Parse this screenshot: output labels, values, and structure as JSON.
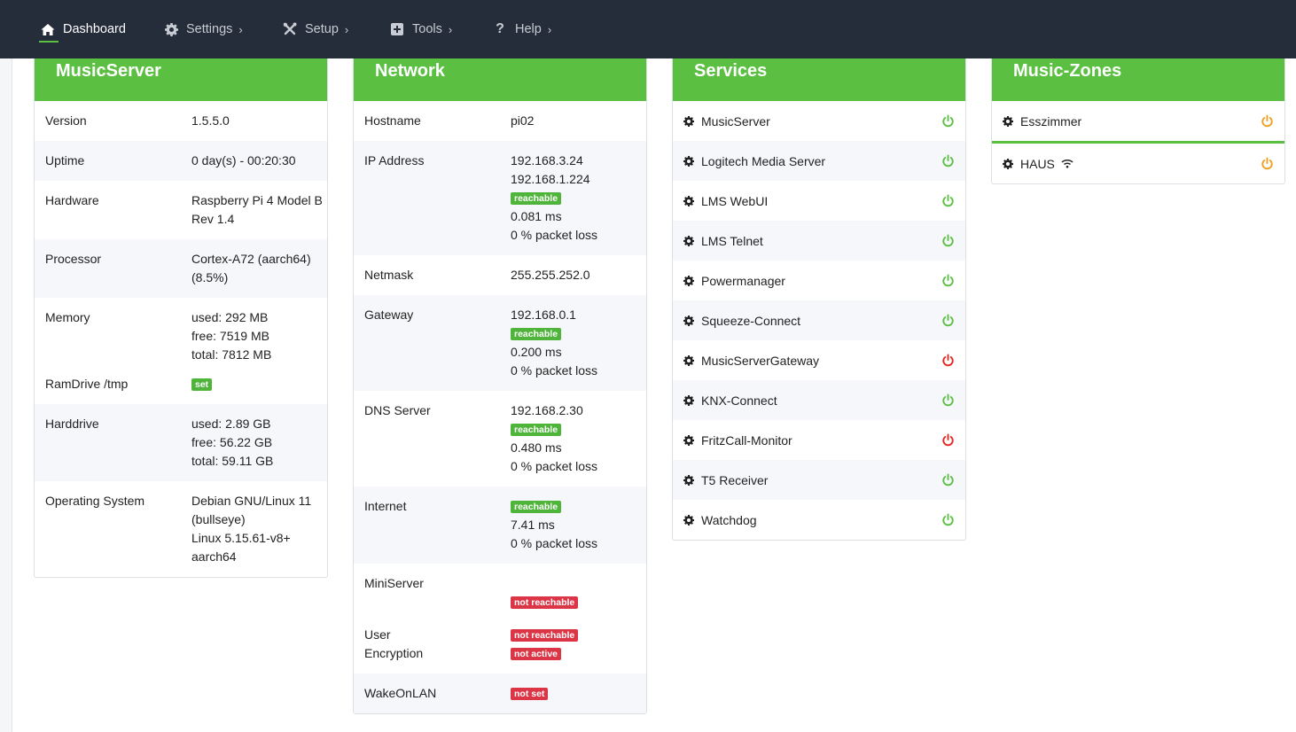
{
  "nav": {
    "dashboard": "Dashboard",
    "settings": "Settings",
    "setup": "Setup",
    "tools": "Tools",
    "help": "Help",
    "chevron": "›"
  },
  "colors": {
    "accent": "#5bbf42",
    "nav_bg": "#252d3a",
    "on": "#5bbf42",
    "off": "#e52620",
    "standby": "#f0a020",
    "danger": "#dc3545"
  },
  "musicserver": {
    "title": "MusicServer",
    "version_k": "Version",
    "version_v": "1.5.5.0",
    "uptime_k": "Uptime",
    "uptime_v": "0 day(s) - 00:20:30",
    "hardware_k": "Hardware",
    "hardware_v": "Raspberry Pi 4 Model B Rev 1.4",
    "processor_k": "Processor",
    "processor_v": "Cortex-A72 (aarch64) (8.5%)",
    "memory_k": "Memory",
    "memory_used": "used: 292 MB",
    "memory_free": "free: 7519 MB",
    "memory_total": "total: 7812 MB",
    "ramdrive_k": "RamDrive /tmp",
    "ramdrive_badge": "set",
    "harddrive_k": "Harddrive",
    "hd_used": "used: 2.89 GB",
    "hd_free": "free: 56.22 GB",
    "hd_total": "total: 59.11 GB",
    "os_k": "Operating System",
    "os_1": "Debian GNU/Linux 11 (bullseye)",
    "os_2": "Linux 5.15.61-v8+ aarch64"
  },
  "network": {
    "title": "Network",
    "hostname_k": "Hostname",
    "hostname_v": "pi02",
    "ip_k": "IP Address",
    "ip_1": "192.168.3.24",
    "ip_2": "192.168.1.224",
    "ip_badge": "reachable",
    "ip_ms": "0.081 ms",
    "ip_loss": "0 % packet loss",
    "netmask_k": "Netmask",
    "netmask_v": "255.255.252.0",
    "gw_k": "Gateway",
    "gw_v": "192.168.0.1",
    "gw_badge": "reachable",
    "gw_ms": "0.200 ms",
    "gw_loss": "0 % packet loss",
    "dns_k": "DNS Server",
    "dns_v": "192.168.2.30",
    "dns_badge": "reachable",
    "dns_ms": "0.480 ms",
    "dns_loss": "0 % packet loss",
    "inet_k": "Internet",
    "inet_badge": "reachable",
    "inet_ms": "7.41 ms",
    "inet_loss": "0 % packet loss",
    "mini_k": "MiniServer",
    "mini_badge": "not reachable",
    "user_k": "User",
    "enc_k": "Encryption",
    "user_badge": "not reachable",
    "enc_badge": "not active",
    "wol_k": "WakeOnLAN",
    "wol_badge": "not set"
  },
  "services": {
    "title": "Services",
    "items": [
      {
        "name": "MusicServer",
        "status": "on"
      },
      {
        "name": "Logitech Media Server",
        "status": "on"
      },
      {
        "name": "LMS WebUI",
        "status": "on"
      },
      {
        "name": "LMS Telnet",
        "status": "on"
      },
      {
        "name": "Powermanager",
        "status": "on"
      },
      {
        "name": "Squeeze-Connect",
        "status": "on"
      },
      {
        "name": "MusicServerGateway",
        "status": "off"
      },
      {
        "name": "KNX-Connect",
        "status": "on"
      },
      {
        "name": "FritzCall-Monitor",
        "status": "off"
      },
      {
        "name": "T5 Receiver",
        "status": "on"
      },
      {
        "name": "Watchdog",
        "status": "on"
      }
    ]
  },
  "zones": {
    "title": "Music-Zones",
    "items": [
      {
        "name": "Esszimmer",
        "status": "standby"
      },
      {
        "name": "HAUS",
        "status": "standby",
        "icon": "wifi-icon"
      }
    ]
  }
}
